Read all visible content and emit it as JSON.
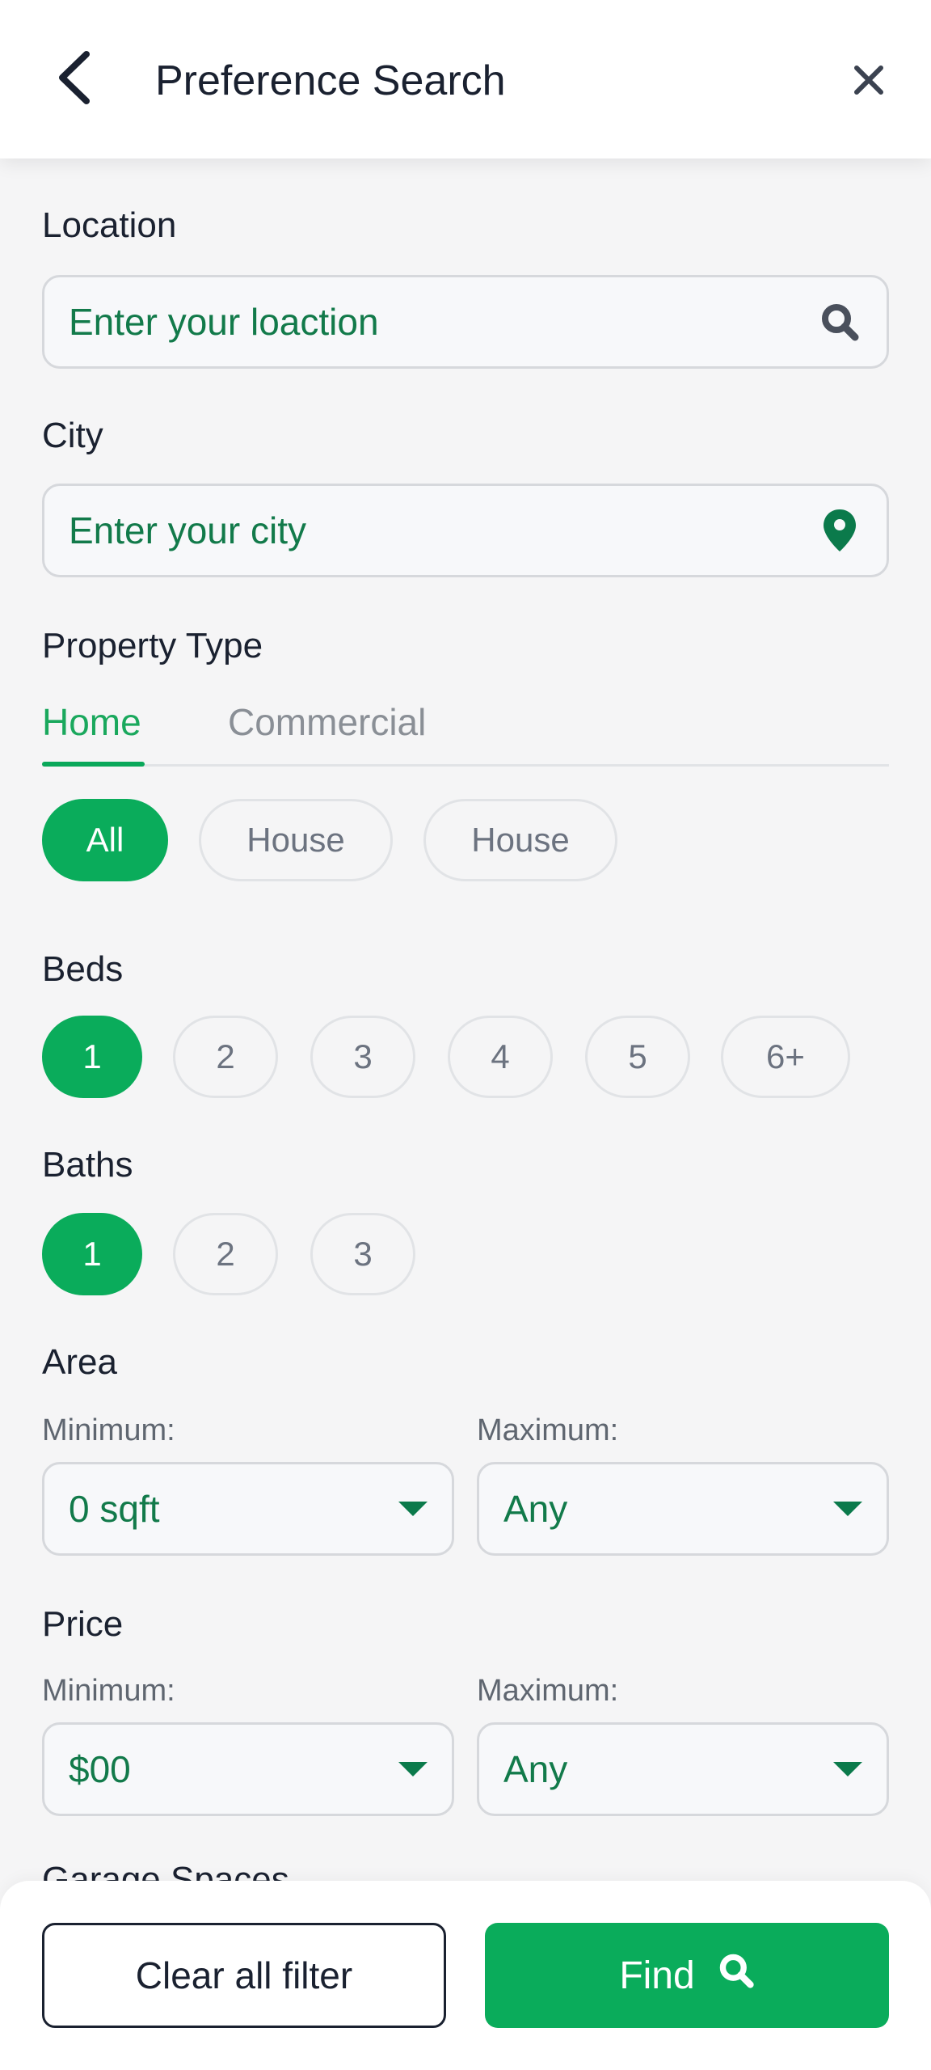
{
  "header": {
    "title": "Preference Search"
  },
  "location": {
    "label": "Location",
    "placeholder": "Enter your loaction"
  },
  "city": {
    "label": "City",
    "placeholder": "Enter your city"
  },
  "property_type": {
    "label": "Property Type",
    "tabs": [
      {
        "label": "Home",
        "active": true
      },
      {
        "label": "Commercial",
        "active": false
      }
    ],
    "chips": [
      {
        "label": "All",
        "selected": true
      },
      {
        "label": "House",
        "selected": false
      },
      {
        "label": "House",
        "selected": false
      }
    ]
  },
  "beds": {
    "label": "Beds",
    "options": [
      "1",
      "2",
      "3",
      "4",
      "5",
      "6+"
    ],
    "selected": "1"
  },
  "baths": {
    "label": "Baths",
    "options": [
      "1",
      "2",
      "3"
    ],
    "selected": "1"
  },
  "area": {
    "label": "Area",
    "min_label": "Minimum:",
    "min_value": "0 sqft",
    "max_label": "Maximum:",
    "max_value": "Any"
  },
  "price": {
    "label": "Price",
    "min_label": "Minimum:",
    "min_value": "$00",
    "max_label": "Maximum:",
    "max_value": "Any"
  },
  "garage": {
    "label": "Garage Spaces"
  },
  "footer": {
    "clear_label": "Clear all filter",
    "find_label": "Find"
  },
  "colors": {
    "accent": "#0aac5b",
    "accent_text": "#127a4a",
    "icon_green": "#0b7a4b"
  }
}
